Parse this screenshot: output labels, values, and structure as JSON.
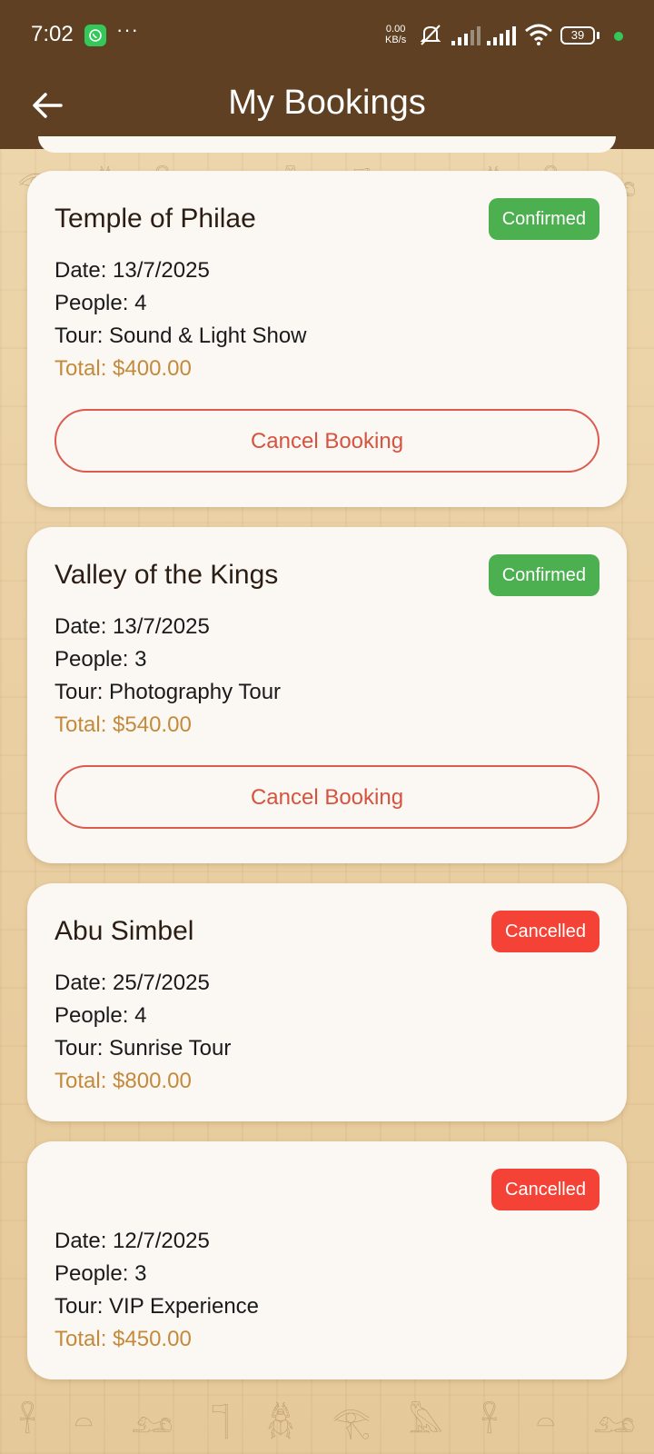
{
  "status_bar": {
    "time": "7:02",
    "network_speed_value": "0.00",
    "network_speed_unit": "KB/s",
    "battery": "39",
    "icons": [
      "whatsapp-icon",
      "more-dots-icon",
      "alarm-off-icon",
      "signal-icon",
      "wifi-icon",
      "battery-icon"
    ]
  },
  "header": {
    "title": "My Bookings",
    "back_icon": "arrow-left-icon"
  },
  "colors": {
    "header_bg": "#5f4022",
    "confirmed": "#4caf50",
    "cancelled": "#f44336",
    "total": "#c48a3b",
    "cancel_button": "#d6533f"
  },
  "bookings": [
    {
      "place": "Temple of Philae",
      "status": "Confirmed",
      "date": "Date: 13/7/2025",
      "people": "People: 4",
      "tour": "Tour: Sound & Light Show",
      "total": "Total: $400.00",
      "cancel_label": "Cancel Booking"
    },
    {
      "place": "Valley of the Kings",
      "status": "Confirmed",
      "date": "Date: 13/7/2025",
      "people": "People: 3",
      "tour": "Tour: Photography Tour",
      "total": "Total: $540.00",
      "cancel_label": "Cancel Booking"
    },
    {
      "place": "Abu Simbel",
      "status": "Cancelled",
      "date": "Date: 25/7/2025",
      "people": "People: 4",
      "tour": "Tour: Sunrise Tour",
      "total": "Total: $800.00"
    },
    {
      "place": "",
      "status": "Cancelled",
      "date": "Date: 12/7/2025",
      "people": "People: 3",
      "tour": "Tour: VIP Experience",
      "total": "Total: $450.00"
    }
  ]
}
